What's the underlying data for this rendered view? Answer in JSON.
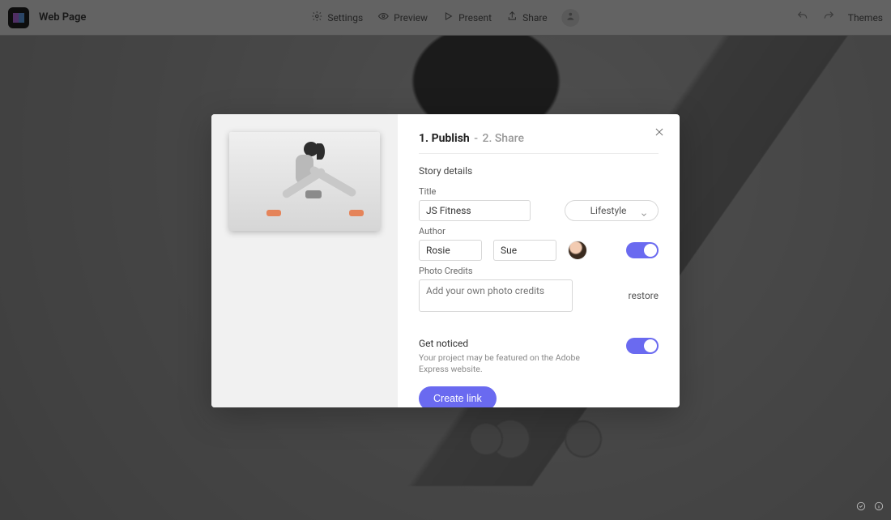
{
  "topbar": {
    "page_name": "Web Page",
    "settings_label": "Settings",
    "preview_label": "Preview",
    "present_label": "Present",
    "share_label": "Share",
    "themes_label": "Themes"
  },
  "modal": {
    "steps": {
      "step1": "1. Publish",
      "step2": "2. Share"
    },
    "story_details_heading": "Story details",
    "title_label": "Title",
    "title_value": "JS Fitness",
    "category_selected": "Lifestyle",
    "author_label": "Author",
    "author1_value": "Rosie",
    "author2_value": "Sue",
    "photo_credits_label": "Photo Credits",
    "photo_credits_placeholder": "Add your own photo credits",
    "restore_label": "restore",
    "get_noticed_heading": "Get noticed",
    "get_noticed_sub": "Your project may be featured on the Adobe Express website.",
    "create_link_label": "Create link",
    "author_toggle_on": true,
    "get_noticed_toggle_on": true
  },
  "colors": {
    "accent": "#6a6af0"
  }
}
